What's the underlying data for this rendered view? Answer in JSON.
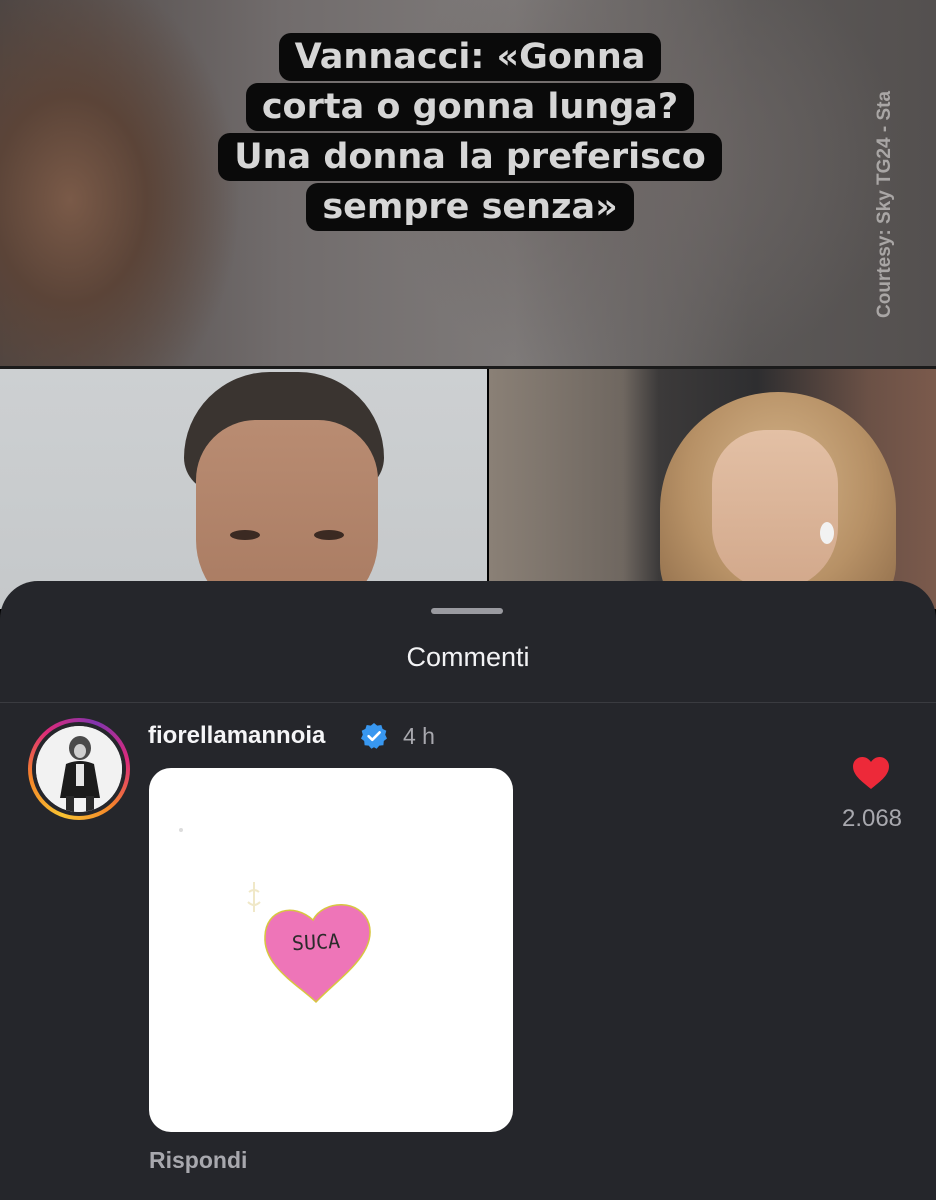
{
  "video": {
    "caption_lines": [
      "Vannacci: «Gonna",
      "corta o gonna lunga?",
      "Una donna la preferisco",
      "sempre senza»"
    ],
    "watermark": "Courtesy: Sky TG24 - Sta"
  },
  "sheet": {
    "title": "Commenti"
  },
  "comment": {
    "username": "fiorellamannoia",
    "verified": true,
    "time": "4 h",
    "sticker_text": "SUCA",
    "reply_label": "Rispondi",
    "likes": "2.068",
    "liked": true
  },
  "colors": {
    "sheet_bg": "#25262b",
    "like_red": "#ed2939",
    "verified_blue": "#3897f0",
    "heart_pink": "#ee75b8"
  }
}
